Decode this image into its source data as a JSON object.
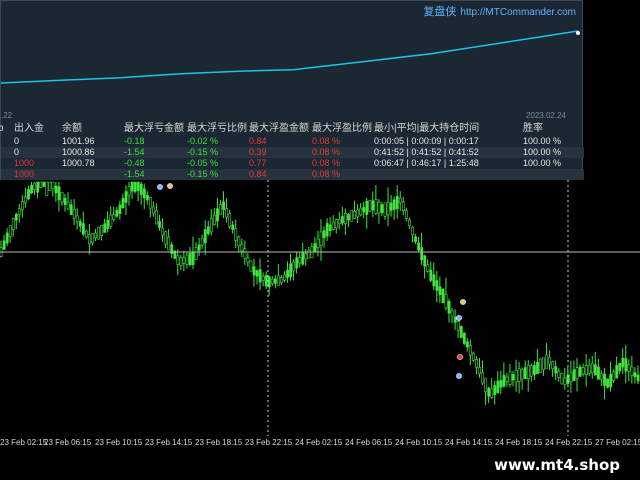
{
  "chart_data": {
    "type": "candlestick",
    "x_labels": [
      "23 Feb 02:15",
      "23 Feb 06:15",
      "23 Feb 10:15",
      "23 Feb 14:15",
      "23 Feb 18:15",
      "23 Feb 22:15",
      "24 Feb 02:15",
      "24 Feb 06:15",
      "24 Feb 10:15",
      "24 Feb 14:15",
      "24 Feb 18:15",
      "24 Feb 22:15",
      "27 Feb 02:15"
    ],
    "series": [
      {
        "values": [
          252,
          218,
          190,
          176,
          195,
          215,
          240,
          228,
          210,
          180,
          200,
          235,
          262,
          258,
          230,
          205,
          240,
          270,
          282,
          280,
          262,
          252,
          230,
          220,
          214,
          205,
          210,
          200,
          240,
          275,
          300,
          330,
          360,
          395,
          380,
          375,
          370,
          360,
          382,
          372,
          368,
          384,
          362,
          378
        ]
      }
    ],
    "crosshair_visible": true,
    "colors": {
      "candle": "#3ee63e",
      "background": "#000000"
    }
  },
  "brand": {
    "cn": "复盘侠",
    "url": "http://MTCommander.com"
  },
  "equity": {
    "date_left": ".22",
    "date_right": "2023.02.24",
    "line_color": "#19c6e8",
    "values": [
      1000.0,
      1000.1,
      1000.2,
      1000.35,
      1000.45,
      1000.5,
      1001.1,
      1001.96
    ]
  },
  "table": {
    "headers": [
      "b",
      "出入金",
      "余额",
      "最大浮亏金额",
      "最大浮亏比例",
      "最大浮盈金额",
      "最大浮盈比例",
      "最小|平均|最大持仓时间",
      "胜率"
    ],
    "rows": [
      {
        "deposit": "0",
        "balance": "1001.96",
        "max_loss": "-0.18",
        "max_loss_pct": "-0.02 %",
        "max_profit": "0.84",
        "max_profit_pct": "0.08 %",
        "hold": "0:00:05 | 0:00:09 | 0:00:17",
        "win": "100.00 %"
      },
      {
        "deposit": "0",
        "balance": "1000.86",
        "max_loss": "-1.54",
        "max_loss_pct": "-0.15 %",
        "max_profit": "0.39",
        "max_profit_pct": "0.08 %",
        "hold": "0:41:52 | 0:41:52 | 0:41:52",
        "win": "100.00 %"
      },
      {
        "deposit": "1000",
        "balance": "1000.78",
        "max_loss": "-0.48",
        "max_loss_pct": "-0.05 %",
        "max_profit": "0.77",
        "max_profit_pct": "0.08 %",
        "hold": "0:06:47 | 0:46:17 | 1:25:48",
        "win": "100.00 %"
      },
      {
        "deposit": "1000",
        "balance": "",
        "max_loss": "-1.54",
        "max_loss_pct": "-0.15 %",
        "max_profit": "0.84",
        "max_profit_pct": "0.08 %",
        "hold": "",
        "win": ""
      }
    ]
  },
  "watermark": "www.mt4.shop"
}
